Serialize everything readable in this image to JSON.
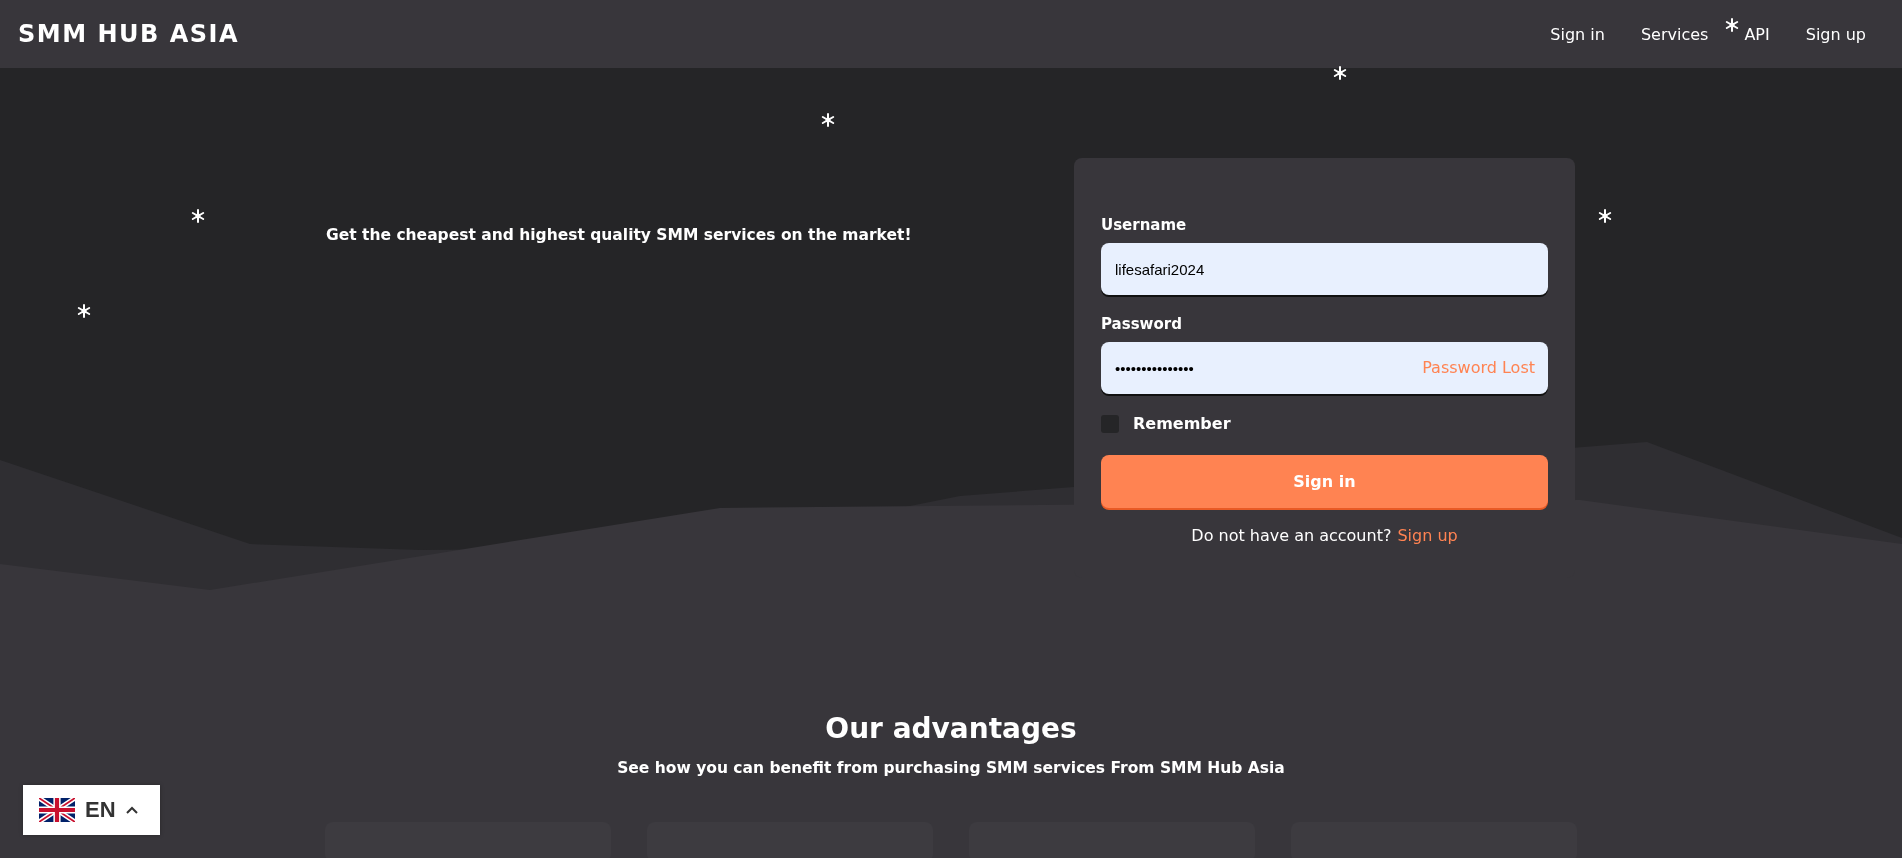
{
  "header": {
    "logo": "SMM HUB ASIA",
    "nav": [
      {
        "label": "Sign in"
      },
      {
        "label": "Services"
      },
      {
        "label": "API"
      },
      {
        "label": "Sign up"
      }
    ]
  },
  "hero": {
    "tagline": "Get the cheapest and highest quality SMM services on the market!"
  },
  "login": {
    "username": {
      "label": "Username",
      "value": "lifesafari2024"
    },
    "password": {
      "label": "Password",
      "value": "•••••••••••••••",
      "link": "Password Lost"
    },
    "remember": {
      "label": "Remember",
      "checked": false
    },
    "submit": "Sign in",
    "footer": {
      "text": "Do not have an account?",
      "link": "Sign up"
    }
  },
  "advantages": {
    "title": "Our advantages",
    "subtitle": "See how you can benefit from purchasing SMM services From SMM Hub Asia"
  },
  "language": {
    "code": "EN"
  }
}
